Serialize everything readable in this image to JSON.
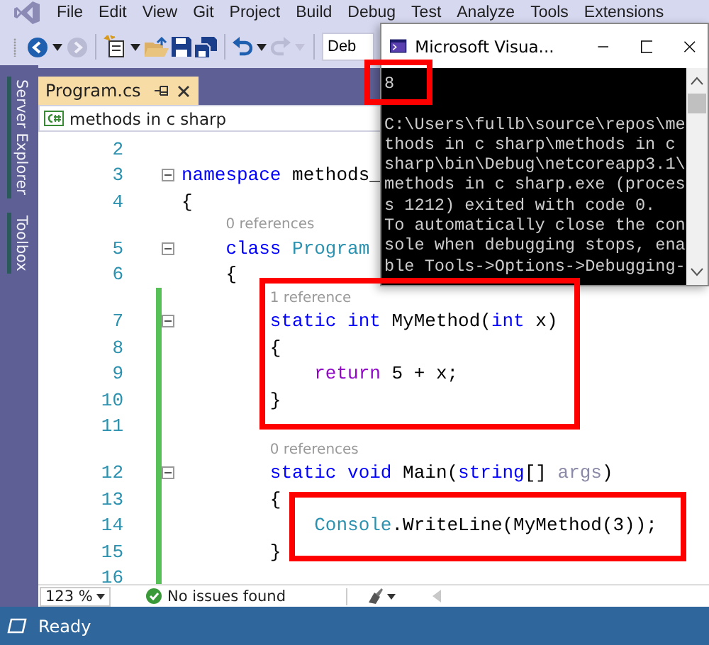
{
  "menu": [
    "File",
    "Edit",
    "View",
    "Git",
    "Project",
    "Build",
    "Debug",
    "Test",
    "Analyze",
    "Tools",
    "Extensions"
  ],
  "toolbar_groups": [
    [
      {
        "kind": "back",
        "disabled": false
      },
      {
        "kind": "caret",
        "disabled": false
      },
      {
        "kind": "forward",
        "disabled": true
      }
    ],
    [
      {
        "kind": "new-item",
        "disabled": false
      },
      {
        "kind": "caret",
        "disabled": false
      },
      {
        "kind": "open",
        "disabled": false
      },
      {
        "kind": "save",
        "disabled": false
      },
      {
        "kind": "save-all",
        "disabled": false
      }
    ],
    [
      {
        "kind": "undo",
        "disabled": false
      },
      {
        "kind": "caret",
        "disabled": false
      },
      {
        "kind": "redo",
        "disabled": true
      },
      {
        "kind": "caret",
        "disabled": true
      }
    ]
  ],
  "config_dropdown": "Deb",
  "side_tabs": [
    "Server Explorer",
    "Toolbox"
  ],
  "document_tab": {
    "title": "Program.cs",
    "selected": true
  },
  "nav_bar": {
    "project": "methods in c sharp"
  },
  "code_lines": [
    {
      "kind": "code",
      "number": "2",
      "changed": false,
      "fold": false
    },
    {
      "kind": "code",
      "number": "3",
      "changed": false,
      "fold": true,
      "tokens": [
        {
          "text": "namespace",
          "kind": "keyword"
        },
        {
          "text": " methods_",
          "kind": "plain"
        }
      ]
    },
    {
      "kind": "code",
      "number": "4",
      "changed": false,
      "fold": false,
      "tokens": [
        {
          "text": "{",
          "kind": "plain"
        }
      ]
    },
    {
      "kind": "lens",
      "text": "0 references",
      "changed": false
    },
    {
      "kind": "code",
      "number": "5",
      "changed": false,
      "fold": true,
      "tokens": [
        {
          "text": "    class",
          "kind": "keyword"
        },
        {
          "text": " Program",
          "kind": "type"
        }
      ]
    },
    {
      "kind": "code",
      "number": "6",
      "changed": false,
      "fold": false,
      "tokens": [
        {
          "text": "    {",
          "kind": "plain"
        }
      ]
    },
    {
      "kind": "lens",
      "text": "1 reference",
      "changed": true
    },
    {
      "kind": "code",
      "number": "7",
      "changed": true,
      "fold": true,
      "tokens": [
        {
          "text": "        static int",
          "kind": "keyword"
        },
        {
          "text": " MyMethod(",
          "kind": "plain"
        },
        {
          "text": "int",
          "kind": "keyword"
        },
        {
          "text": " x)",
          "kind": "plain"
        }
      ]
    },
    {
      "kind": "code",
      "number": "8",
      "changed": true,
      "fold": false,
      "tokens": [
        {
          "text": "        {",
          "kind": "plain"
        }
      ]
    },
    {
      "kind": "code",
      "number": "9",
      "changed": true,
      "fold": false,
      "tokens": [
        {
          "text": "            return",
          "kind": "control"
        },
        {
          "text": " 5 + x;",
          "kind": "plain"
        }
      ]
    },
    {
      "kind": "code",
      "number": "10",
      "changed": true,
      "fold": false,
      "tokens": [
        {
          "text": "        }",
          "kind": "plain"
        }
      ]
    },
    {
      "kind": "code",
      "number": "11",
      "changed": true,
      "fold": false
    },
    {
      "kind": "lens",
      "text": "0 references",
      "changed": true
    },
    {
      "kind": "code",
      "number": "12",
      "changed": true,
      "fold": true,
      "tokens": [
        {
          "text": "        static void",
          "kind": "keyword"
        },
        {
          "text": " Main(",
          "kind": "plain"
        },
        {
          "text": "string",
          "kind": "keyword"
        },
        {
          "text": "[] ",
          "kind": "plain"
        },
        {
          "text": "args",
          "kind": "muted"
        },
        {
          "text": ")",
          "kind": "plain"
        }
      ]
    },
    {
      "kind": "code",
      "number": "13",
      "changed": true,
      "fold": false,
      "tokens": [
        {
          "text": "        {",
          "kind": "plain"
        }
      ]
    },
    {
      "kind": "code",
      "number": "14",
      "changed": true,
      "fold": false,
      "tokens": [
        {
          "text": "            Console",
          "kind": "type"
        },
        {
          "text": ".WriteLine(MyMethod(3));",
          "kind": "plain"
        }
      ]
    },
    {
      "kind": "code",
      "number": "15",
      "changed": true,
      "fold": false,
      "tokens": [
        {
          "text": "        }",
          "kind": "plain"
        }
      ]
    },
    {
      "kind": "code",
      "number": "16",
      "changed": true,
      "fold": false
    }
  ],
  "status_row": {
    "zoom": "123 %",
    "issues": "No issues found"
  },
  "status_bar": {
    "text": "Ready"
  },
  "console": {
    "title": "Microsoft Visua...",
    "output": [
      "8"
    ],
    "message_lines": [
      "C:\\Users\\fullb\\source\\repos\\me",
      "thods in c sharp\\methods in c",
      "sharp\\bin\\Debug\\netcoreapp3.1\\",
      "methods in c sharp.exe (proces",
      "s 1212) exited with code 0.",
      "To automatically close the con",
      "sole when debugging stops, ena",
      "ble Tools->Options->Debugging-"
    ]
  }
}
